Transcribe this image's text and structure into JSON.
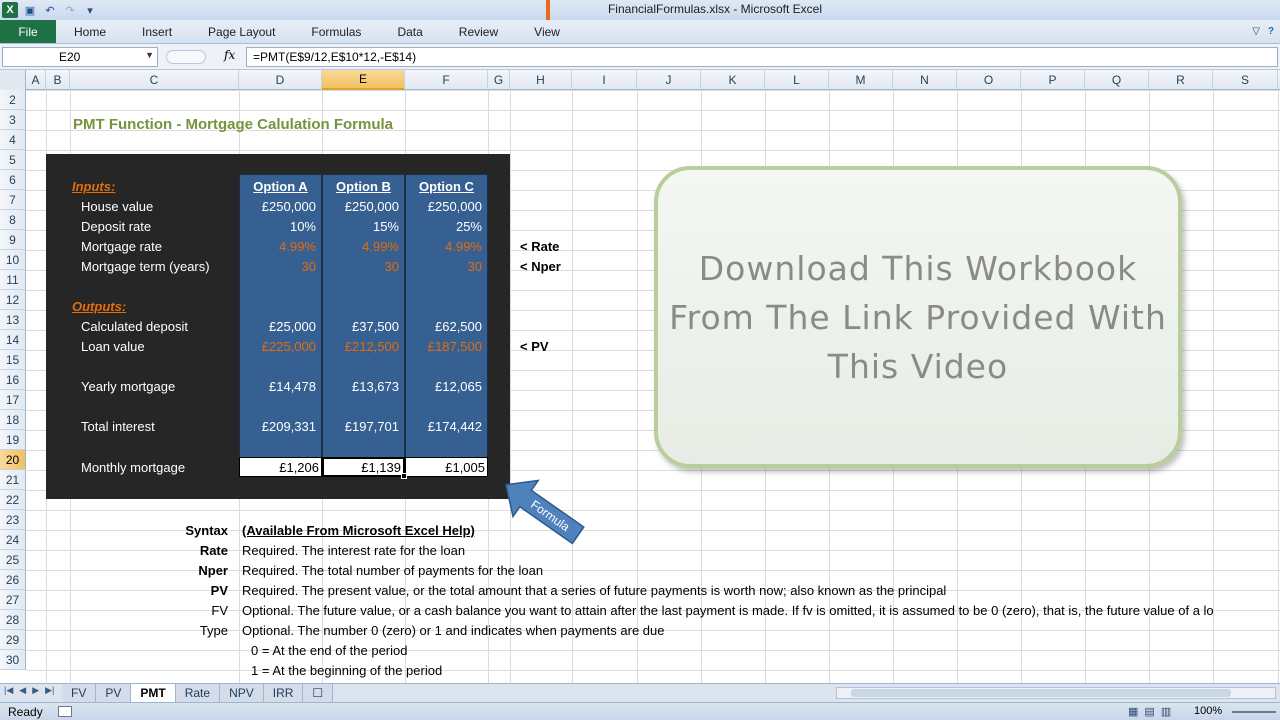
{
  "window": {
    "title": "FinancialFormulas.xlsx  -  Microsoft Excel"
  },
  "ribbon": {
    "tabs": [
      "File",
      "Home",
      "Insert",
      "Page Layout",
      "Formulas",
      "Data",
      "Review",
      "View"
    ]
  },
  "formula_bar": {
    "name_box": "E20",
    "fx": "fx",
    "formula": "=PMT(E$9/12,E$10*12,-E$14)"
  },
  "columns": [
    "A",
    "B",
    "C",
    "D",
    "E",
    "F",
    "G",
    "H",
    "I",
    "J",
    "K",
    "L",
    "M",
    "N",
    "O",
    "P",
    "Q",
    "R",
    "S"
  ],
  "rows": [
    "2",
    "3",
    "4",
    "5",
    "6",
    "7",
    "8",
    "9",
    "10",
    "11",
    "12",
    "13",
    "14",
    "15",
    "16",
    "17",
    "18",
    "19",
    "20",
    "21",
    "22",
    "23",
    "24",
    "25",
    "26",
    "27",
    "28",
    "29",
    "30"
  ],
  "sheet": {
    "title": "PMT Function - Mortgage Calulation Formula",
    "inputs_label": "Inputs:",
    "outputs_label": "Outputs:",
    "options": [
      "Option A",
      "Option B",
      "Option C"
    ],
    "rows": [
      {
        "label": "House value",
        "values": [
          "£250,000",
          "£250,000",
          "£250,000"
        ],
        "style": "white"
      },
      {
        "label": "Deposit rate",
        "values": [
          "10%",
          "15%",
          "25%"
        ],
        "style": "white"
      },
      {
        "label": "Mortgage rate",
        "values": [
          "4.99%",
          "4.99%",
          "4.99%"
        ],
        "style": "orange",
        "note": "< Rate"
      },
      {
        "label": "Mortgage term (years)",
        "values": [
          "30",
          "30",
          "30"
        ],
        "style": "orange",
        "note": "< Nper"
      },
      {
        "label": "Calculated deposit",
        "values": [
          "£25,000",
          "£37,500",
          "£62,500"
        ],
        "style": "white"
      },
      {
        "label": "Loan value",
        "values": [
          "£225,000",
          "£212,500",
          "£187,500"
        ],
        "style": "orange",
        "note": "< PV"
      },
      {
        "label": "Yearly mortgage",
        "values": [
          "£14,478",
          "£13,673",
          "£12,065"
        ],
        "style": "white"
      },
      {
        "label": "Total interest",
        "values": [
          "£209,331",
          "£197,701",
          "£174,442"
        ],
        "style": "white"
      },
      {
        "label": "Monthly mortgage",
        "values": [
          "£1,206",
          "£1,139",
          "£1,005"
        ],
        "style": "result"
      }
    ],
    "arrow_label": "Formula",
    "syntax": {
      "header_label": "Syntax",
      "header_text": "(Available From Microsoft Excel Help)",
      "items": [
        {
          "name": "Rate",
          "text": "Required. The interest rate for the loan",
          "bold": true
        },
        {
          "name": "Nper",
          "text": "Required. The total number of payments for the loan",
          "bold": true
        },
        {
          "name": "PV",
          "text": "Required. The present value, or the total amount that a series of future payments is worth now; also known as the principal",
          "bold": true
        },
        {
          "name": "FV",
          "text": "Optional. The future value, or a cash balance you want to attain after the last payment is made. If fv is omitted, it is assumed to be 0 (zero), that is, the future value of a lo",
          "bold": false
        },
        {
          "name": "Type",
          "text": "Optional. The number 0 (zero) or 1 and indicates when payments are due",
          "bold": false
        }
      ],
      "type_options": [
        "0 = At the end of the period",
        "1 = At the beginning of the period"
      ]
    }
  },
  "callout": {
    "lines": [
      "Download This Workbook",
      "From The Link Provided With",
      "This Video"
    ]
  },
  "sheet_tabs": [
    "FV",
    "PV",
    "PMT",
    "Rate",
    "NPV",
    "IRR"
  ],
  "active_sheet": "PMT",
  "status": {
    "ready": "Ready",
    "zoom": "100%"
  },
  "colors": {
    "accent_title": "#77933c",
    "option_blue": "#366092",
    "orange": "#e46c0a",
    "excel_green": "#1e7145"
  }
}
